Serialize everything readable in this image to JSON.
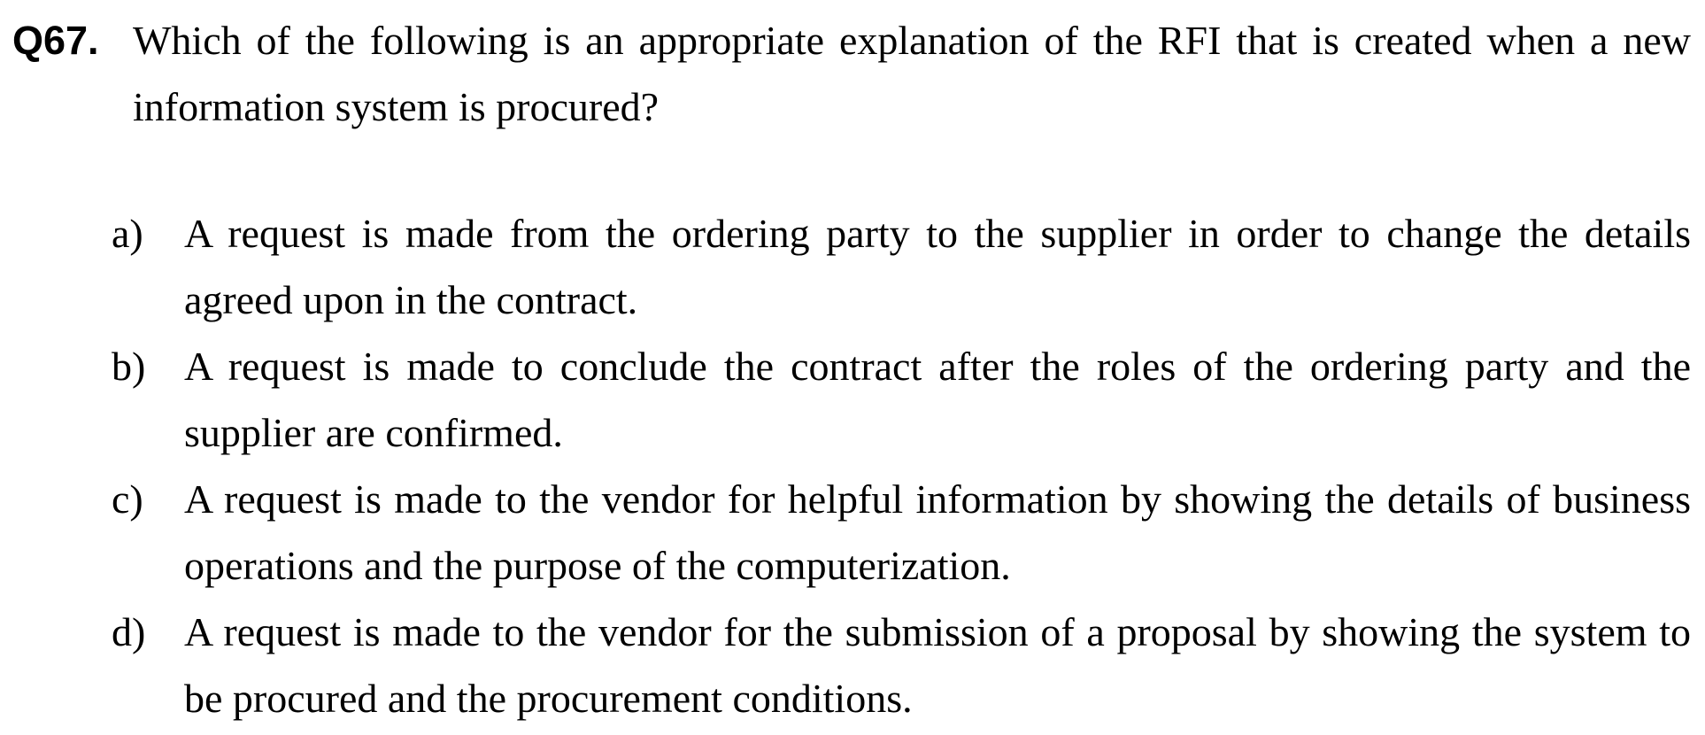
{
  "question": {
    "number": "Q67.",
    "text": "Which of the following is an appropriate explanation of the RFI that is created when a new information system is procured?"
  },
  "options": [
    {
      "letter": "a)",
      "text": "A request is made from the ordering party to the supplier in order to change the details agreed upon in the contract."
    },
    {
      "letter": "b)",
      "text": "A request is made to conclude the contract after the roles of the ordering party and the supplier are confirmed."
    },
    {
      "letter": "c)",
      "text": "A request is made to the vendor for helpful information by showing the details of business operations and the purpose of the computerization."
    },
    {
      "letter": "d)",
      "text": "A request is made to the vendor for the submission of a proposal by showing the system to be procured and the procurement conditions."
    }
  ]
}
